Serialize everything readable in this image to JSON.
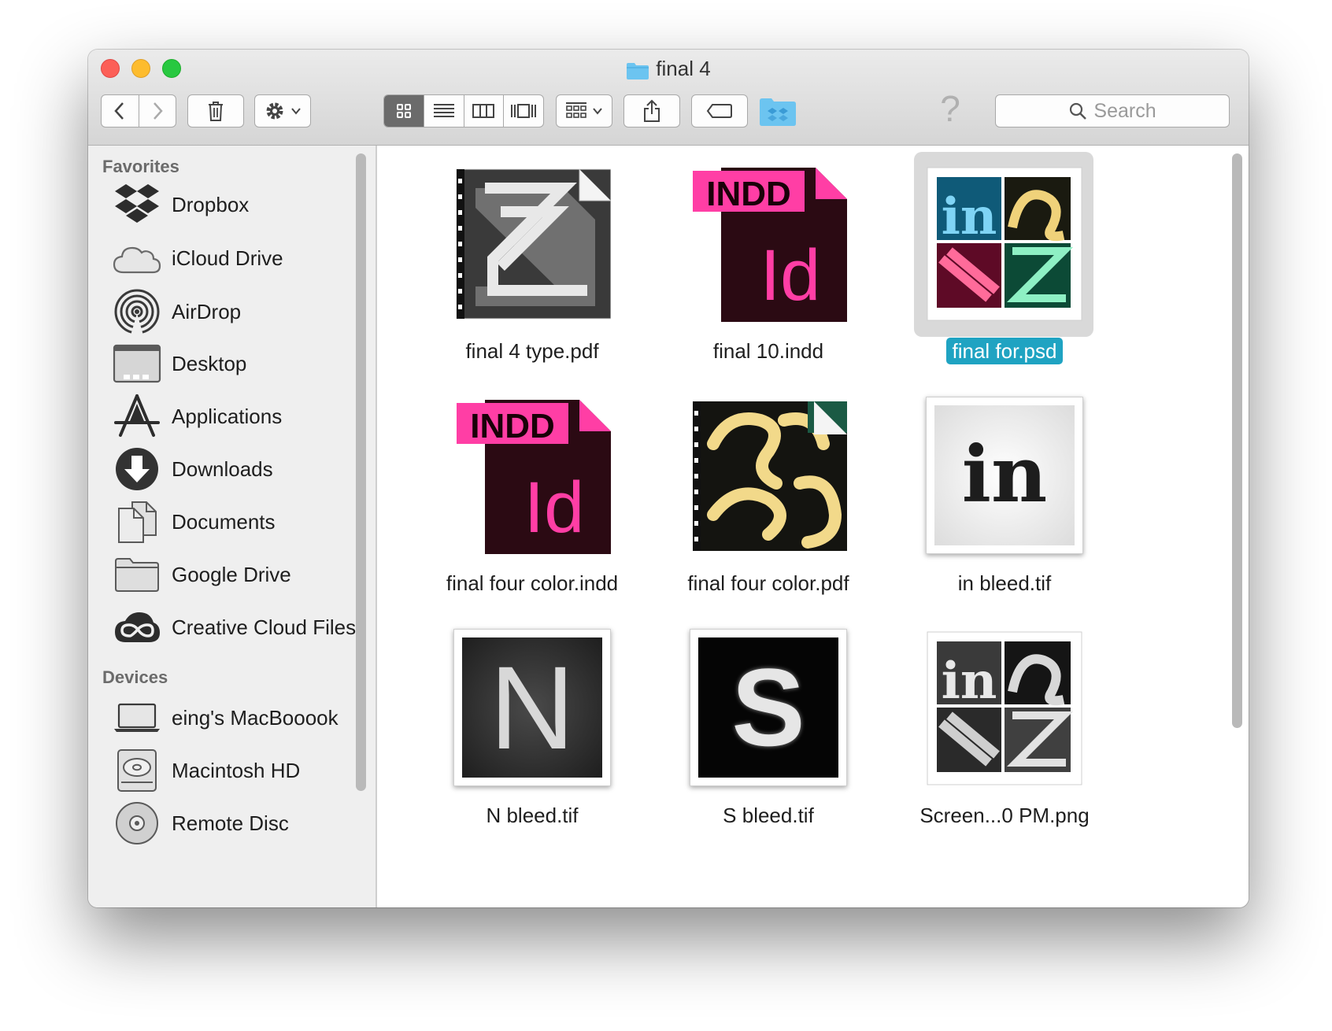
{
  "window": {
    "title": "final 4",
    "search": {
      "placeholder": "Search"
    }
  },
  "toolbar": {
    "buttons": [
      "back",
      "forward",
      "trash",
      "action-menu",
      "view-icons",
      "view-list",
      "view-columns",
      "view-coverflow",
      "arrange",
      "share",
      "tags",
      "dropbox",
      "help"
    ],
    "active_view": "icons"
  },
  "sidebar": {
    "favorites_heading": "Favorites",
    "favorites": [
      {
        "label": "Dropbox",
        "icon": "dropbox-icon"
      },
      {
        "label": "iCloud Drive",
        "icon": "cloud-icon"
      },
      {
        "label": "AirDrop",
        "icon": "airdrop-icon"
      },
      {
        "label": "Desktop",
        "icon": "desktop-icon"
      },
      {
        "label": "Applications",
        "icon": "applications-icon"
      },
      {
        "label": "Downloads",
        "icon": "downloads-icon"
      },
      {
        "label": "Documents",
        "icon": "documents-icon"
      },
      {
        "label": "Google Drive",
        "icon": "folder-icon"
      },
      {
        "label": "Creative Cloud Files",
        "icon": "creative-cloud-icon"
      }
    ],
    "devices_heading": "Devices",
    "devices": [
      {
        "label": "eing's MacBooook",
        "icon": "laptop-icon"
      },
      {
        "label": "Macintosh HD",
        "icon": "harddisk-icon"
      },
      {
        "label": "Remote Disc",
        "icon": "disc-icon"
      }
    ]
  },
  "files": [
    {
      "name": "final 4 type.pdf",
      "kind": "pdf",
      "selected": false
    },
    {
      "name": "final 10.indd",
      "kind": "indd",
      "badge": "INDD",
      "glyph": "Id",
      "selected": false
    },
    {
      "name": "final for.psd",
      "kind": "psd",
      "selected": true
    },
    {
      "name": "final four color.indd",
      "kind": "indd",
      "badge": "INDD",
      "glyph": "Id",
      "selected": false
    },
    {
      "name": "final four color.pdf",
      "kind": "pdf",
      "selected": false
    },
    {
      "name": "in bleed.tif",
      "kind": "tif",
      "glyph": "in",
      "selected": false
    },
    {
      "name": "N bleed.tif",
      "kind": "tif",
      "glyph": "N",
      "selected": false
    },
    {
      "name": "S bleed.tif",
      "kind": "tif",
      "glyph": "S",
      "selected": false
    },
    {
      "name": "Screen...0 PM.png",
      "kind": "png",
      "selected": false
    }
  ],
  "colors": {
    "selection": "#1fa3c2",
    "indd_pink": "#ff3ea5",
    "indd_dark": "#2b0a13",
    "folder_blue": "#6cc4f0"
  }
}
